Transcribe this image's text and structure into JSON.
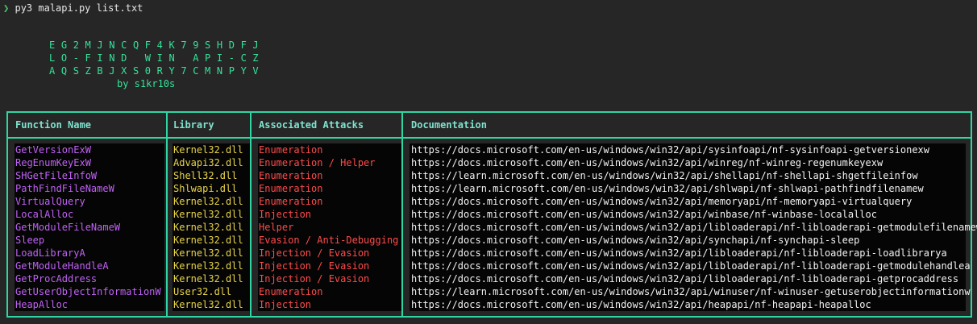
{
  "terminal": {
    "prompt_symbol": "❯",
    "command": "py3 malapi.py list.txt"
  },
  "banner": {
    "lines": [
      "E G 2 M J N C Q F 4 K 7 9 S H D F J",
      "L O - F I N D   W I N   A P I - C Z",
      "A Q S Z B J X S 0 R Y 7 C M N P Y V"
    ],
    "byline": "by s1kr10s"
  },
  "table": {
    "headers": {
      "function": "Function Name",
      "library": "Library",
      "attacks": "Associated Attacks",
      "docs": "Documentation"
    },
    "rows": [
      {
        "function": "GetVersionExW",
        "library": "Kernel32.dll",
        "attacks": "Enumeration",
        "docs": "https://docs.microsoft.com/en-us/windows/win32/api/sysinfoapi/nf-sysinfoapi-getversionexw"
      },
      {
        "function": "RegEnumKeyExW",
        "library": "Advapi32.dll",
        "attacks": "Enumeration / Helper",
        "docs": "https://docs.microsoft.com/en-us/windows/win32/api/winreg/nf-winreg-regenumkeyexw"
      },
      {
        "function": "SHGetFileInfoW",
        "library": "Shell32.dll",
        "attacks": "Enumeration",
        "docs": "https://learn.microsoft.com/en-us/windows/win32/api/shellapi/nf-shellapi-shgetfileinfow"
      },
      {
        "function": "PathFindFileNameW",
        "library": "Shlwapi.dll",
        "attacks": "Enumeration",
        "docs": "https://learn.microsoft.com/en-us/windows/win32/api/shlwapi/nf-shlwapi-pathfindfilenamew"
      },
      {
        "function": "VirtualQuery",
        "library": "Kernel32.dll",
        "attacks": "Enumeration",
        "docs": "https://docs.microsoft.com/en-us/windows/win32/api/memoryapi/nf-memoryapi-virtualquery"
      },
      {
        "function": "LocalAlloc",
        "library": "Kernel32.dll",
        "attacks": "Injection",
        "docs": "https://docs.microsoft.com/en-us/windows/win32/api/winbase/nf-winbase-localalloc"
      },
      {
        "function": "GetModuleFileNameW",
        "library": "Kernel32.dll",
        "attacks": "Helper",
        "docs": "https://docs.microsoft.com/en-us/windows/win32/api/libloaderapi/nf-libloaderapi-getmodulefilenamew"
      },
      {
        "function": "Sleep",
        "library": "Kernel32.dll",
        "attacks": "Evasion / Anti-Debugging",
        "docs": "https://docs.microsoft.com/en-us/windows/win32/api/synchapi/nf-synchapi-sleep"
      },
      {
        "function": "LoadLibraryA",
        "library": "Kernel32.dll",
        "attacks": "Injection / Evasion",
        "docs": "https://docs.microsoft.com/en-us/windows/win32/api/libloaderapi/nf-libloaderapi-loadlibrarya"
      },
      {
        "function": "GetModuleHandleA",
        "library": "Kernel32.dll",
        "attacks": "Injection / Evasion",
        "docs": "https://docs.microsoft.com/en-us/windows/win32/api/libloaderapi/nf-libloaderapi-getmodulehandlea"
      },
      {
        "function": "GetProcAddress",
        "library": "Kernel32.dll",
        "attacks": "Injection / Evasion",
        "docs": "https://docs.microsoft.com/en-us/windows/win32/api/libloaderapi/nf-libloaderapi-getprocaddress"
      },
      {
        "function": "GetUserObjectInformationW",
        "library": "User32.dll",
        "attacks": "Enumeration",
        "docs": "https://learn.microsoft.com/en-us/windows/win32/api/winuser/nf-winuser-getuserobjectinformationw"
      },
      {
        "function": "HeapAlloc",
        "library": "Kernel32.dll",
        "attacks": "Injection",
        "docs": "https://docs.microsoft.com/en-us/windows/win32/api/heapapi/nf-heapapi-heapalloc"
      }
    ]
  },
  "colors": {
    "border": "#2fd6a3",
    "banner": "#34e39a",
    "function_name": "#c061f5",
    "library": "#e8d44a",
    "attacks": "#ff4a4a"
  }
}
